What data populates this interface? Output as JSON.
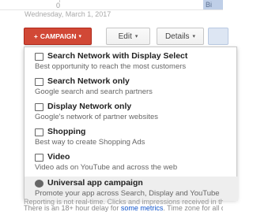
{
  "chart_edge": {
    "zero_label": "0",
    "date_label": "Wednesday, March 1, 2017",
    "corner_label": "Bi"
  },
  "toolbar": {
    "campaign_label": "CAMPAIGN",
    "campaign_plus": "+",
    "edit_label": "Edit",
    "details_label": "Details",
    "caret": "▾"
  },
  "menu": {
    "items": [
      {
        "title": "Search Network with Display Select",
        "description": "Best opportunity to reach the most customers",
        "icon": "search-display-icon"
      },
      {
        "title": "Search Network only",
        "description": "Google search and search partners",
        "icon": "search-network-icon"
      },
      {
        "title": "Display Network only",
        "description": "Google's network of partner websites",
        "icon": "display-network-icon"
      },
      {
        "title": "Shopping",
        "description": "Best way to create Shopping Ads",
        "icon": "shopping-icon"
      },
      {
        "title": "Video",
        "description": "Video ads on YouTube and across the web",
        "icon": "video-icon"
      },
      {
        "title": "Universal app campaign",
        "description": "Promote your app across Search, Display and YouTube",
        "icon": "app-download-icon"
      }
    ],
    "highlighted_index": 5
  },
  "footer": {
    "line1": "Reporting is not real-time. Clicks and impressions received in the last",
    "line2_prefix": "There is an 18+ hour delay for ",
    "line2_link": "some metrics",
    "line2_suffix": ". Time zone for all date"
  },
  "colors": {
    "campaign_button": "#d14836",
    "link": "#1155cc",
    "highlight": "#eeeeee"
  }
}
